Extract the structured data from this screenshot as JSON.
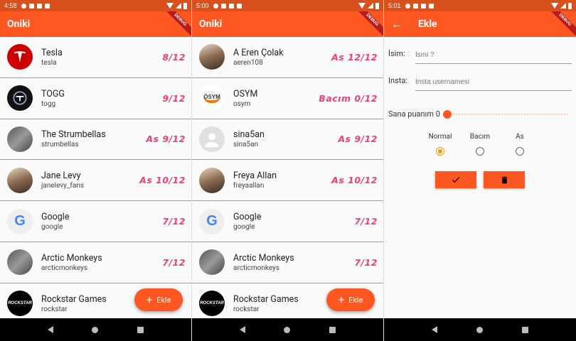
{
  "app_title": "Oniki",
  "debug_banner": "DEBUG",
  "fab_label": "Ekle",
  "screens": [
    {
      "time": "4:58",
      "rows": [
        {
          "name": "Tesla",
          "handle": "tesla",
          "score": "8/12",
          "avatar": "tesla-logo"
        },
        {
          "name": "TOGG",
          "handle": "togg",
          "score": "9/12",
          "avatar": "togg-logo"
        },
        {
          "name": "The Strumbellas",
          "handle": "strumbellas",
          "score": "As 9/12",
          "avatar": "band-photo"
        },
        {
          "name": "Jane Levy",
          "handle": "janelevy_fans",
          "score": "As 10/12",
          "avatar": "person-photo"
        },
        {
          "name": "Google",
          "handle": "google",
          "score": "7/12",
          "avatar": "google-logo"
        },
        {
          "name": "Arctic Monkeys",
          "handle": "arcticmonkeys",
          "score": "7/12",
          "avatar": "band-photo"
        },
        {
          "name": "Rockstar Games",
          "handle": "rockstar",
          "score": "",
          "avatar": "rockstar-logo"
        }
      ]
    },
    {
      "time": "5:00",
      "rows": [
        {
          "name": "A Eren Çolak",
          "handle": "aeren108",
          "score": "As 12/12",
          "avatar": "person-photo"
        },
        {
          "name": "OSYM",
          "handle": "osym",
          "score": "Bacım 0/12",
          "avatar": "osym-logo",
          "avatar_text": "ÖSYM"
        },
        {
          "name": "sina5an",
          "handle": "sina5an",
          "score": "As 9/12",
          "avatar": "default-avatar"
        },
        {
          "name": "Freya Allan",
          "handle": "freyaallan",
          "score": "As 10/12",
          "avatar": "person-photo"
        },
        {
          "name": "Google",
          "handle": "google",
          "score": "7/12",
          "avatar": "google-logo"
        },
        {
          "name": "Arctic Monkeys",
          "handle": "arcticmonkeys",
          "score": "7/12",
          "avatar": "band-photo"
        },
        {
          "name": "Rockstar Games",
          "handle": "rockstar",
          "score": "",
          "avatar": "rockstar-logo"
        }
      ]
    }
  ],
  "form": {
    "time": "5:01",
    "title": "Ekle",
    "name_label": "İsim:",
    "name_placeholder": "İsmi ?",
    "insta_label": "Insta:",
    "insta_placeholder": "Insta usernamesi",
    "slider_label": "Sana puanım 0",
    "slider_value": 0,
    "radio_options": [
      {
        "label": "Normal",
        "selected": true
      },
      {
        "label": "Bacım",
        "selected": false
      },
      {
        "label": "As",
        "selected": false
      }
    ],
    "confirm_icon": "check-icon",
    "delete_icon": "trash-icon"
  },
  "colors": {
    "primary": "#ff5722",
    "statusbar": "#d8501c",
    "score": "#ec407a",
    "radio_selected": "#ff9800"
  }
}
